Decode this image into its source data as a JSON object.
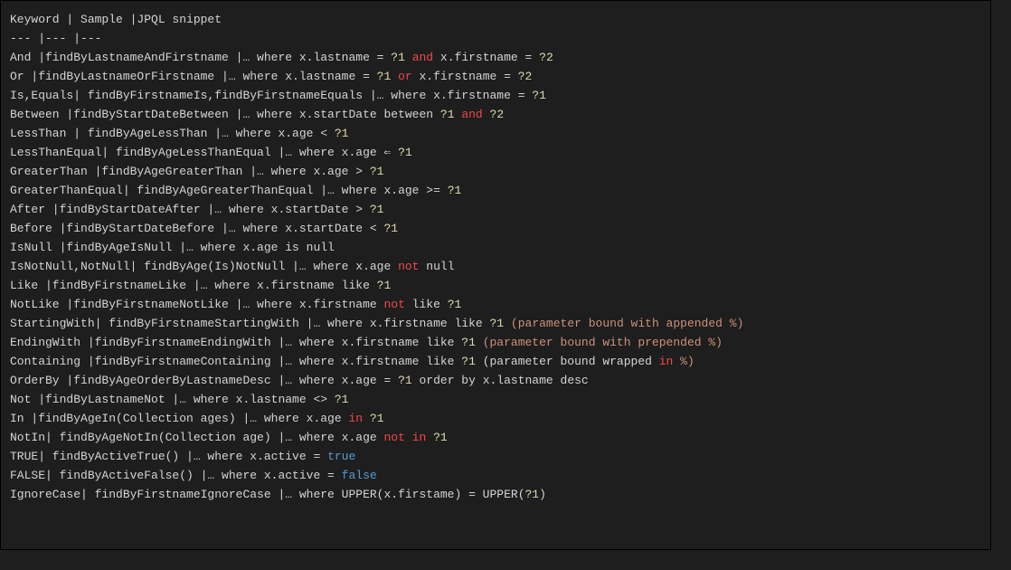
{
  "lines": [
    [
      [
        "white",
        "Keyword | Sample |JPQL snippet"
      ]
    ],
    [
      [
        "white",
        "--- |--- |---"
      ]
    ],
    [
      [
        "white",
        "And |findByLastnameAndFirstname |… where x.lastname = "
      ],
      [
        "yellow",
        "?1"
      ],
      [
        "white",
        " "
      ],
      [
        "red",
        "and"
      ],
      [
        "white",
        " x.firstname = "
      ],
      [
        "yellow",
        "?2"
      ]
    ],
    [
      [
        "white",
        "Or |findByLastnameOrFirstname |… where x.lastname = "
      ],
      [
        "yellow",
        "?1"
      ],
      [
        "white",
        " "
      ],
      [
        "red",
        "or"
      ],
      [
        "white",
        " x.firstname = "
      ],
      [
        "yellow",
        "?2"
      ]
    ],
    [
      [
        "white",
        "Is,Equals| findByFirstnameIs,findByFirstnameEquals |… where x.firstname = "
      ],
      [
        "yellow",
        "?1"
      ]
    ],
    [
      [
        "white",
        "Between |findByStartDateBetween |… where x.startDate between "
      ],
      [
        "yellow",
        "?1"
      ],
      [
        "white",
        " "
      ],
      [
        "red",
        "and"
      ],
      [
        "white",
        " "
      ],
      [
        "yellow",
        "?2"
      ]
    ],
    [
      [
        "white",
        "LessThan | findByAgeLessThan |… where x.age < "
      ],
      [
        "yellow",
        "?1"
      ]
    ],
    [
      [
        "white",
        "LessThanEqual| findByAgeLessThanEqual |… where x.age ⇐ "
      ],
      [
        "yellow",
        "?1"
      ]
    ],
    [
      [
        "white",
        "GreaterThan |findByAgeGreaterThan |… where x.age > "
      ],
      [
        "yellow",
        "?1"
      ]
    ],
    [
      [
        "white",
        "GreaterThanEqual| findByAgeGreaterThanEqual |… where x.age >= "
      ],
      [
        "yellow",
        "?1"
      ]
    ],
    [
      [
        "white",
        "After |findByStartDateAfter |… where x.startDate > "
      ],
      [
        "yellow",
        "?1"
      ]
    ],
    [
      [
        "white",
        "Before |findByStartDateBefore |… where x.startDate < "
      ],
      [
        "yellow",
        "?1"
      ]
    ],
    [
      [
        "white",
        "IsNull |findByAgeIsNull |… where x.age is null"
      ]
    ],
    [
      [
        "white",
        "IsNotNull,NotNull| findByAge(Is)NotNull |… where x.age "
      ],
      [
        "red",
        "not"
      ],
      [
        "white",
        " null"
      ]
    ],
    [
      [
        "white",
        "Like |findByFirstnameLike |… where x.firstname like "
      ],
      [
        "yellow",
        "?1"
      ]
    ],
    [
      [
        "white",
        "NotLike |findByFirstnameNotLike |… where x.firstname "
      ],
      [
        "red",
        "not"
      ],
      [
        "white",
        " like "
      ],
      [
        "yellow",
        "?1"
      ]
    ],
    [
      [
        "white",
        "StartingWith| findByFirstnameStartingWith |… where x.firstname like "
      ],
      [
        "yellow",
        "?1"
      ],
      [
        "white",
        " "
      ],
      [
        "orange",
        "(parameter bound with appended %)"
      ]
    ],
    [
      [
        "white",
        "EndingWith |findByFirstnameEndingWith |… where x.firstname like "
      ],
      [
        "yellow",
        "?1"
      ],
      [
        "white",
        " "
      ],
      [
        "orange",
        "(parameter bound with prepended %)"
      ]
    ],
    [
      [
        "white",
        "Containing |findByFirstnameContaining |… where x.firstname like "
      ],
      [
        "yellow",
        "?1"
      ],
      [
        "white",
        " (parameter bound wrapped "
      ],
      [
        "red",
        "in"
      ],
      [
        "white",
        " "
      ],
      [
        "orange",
        "%)"
      ]
    ],
    [
      [
        "white",
        "OrderBy |findByAgeOrderByLastnameDesc |… where x.age = "
      ],
      [
        "yellow",
        "?1"
      ],
      [
        "white",
        " order by x.lastname desc"
      ]
    ],
    [
      [
        "white",
        "Not |findByLastnameNot |… where x.lastname <> "
      ],
      [
        "yellow",
        "?1"
      ]
    ],
    [
      [
        "white",
        "In |findByAgeIn(Collection ages) |… where x.age "
      ],
      [
        "red",
        "in"
      ],
      [
        "white",
        " "
      ],
      [
        "yellow",
        "?1"
      ]
    ],
    [
      [
        "white",
        "NotIn| findByAgeNotIn(Collection age) |… where x.age "
      ],
      [
        "red",
        "not"
      ],
      [
        "white",
        " "
      ],
      [
        "red",
        "in"
      ],
      [
        "white",
        " "
      ],
      [
        "yellow",
        "?1"
      ]
    ],
    [
      [
        "white",
        "TRUE| findByActiveTrue() |… where x.active = "
      ],
      [
        "blue",
        "true"
      ]
    ],
    [
      [
        "white",
        "FALSE| findByActiveFalse() |… where x.active = "
      ],
      [
        "blue",
        "false"
      ]
    ],
    [
      [
        "white",
        "IgnoreCase| findByFirstnameIgnoreCase |… where UPPER(x.firstame) = UPPER("
      ],
      [
        "yellow",
        "?1"
      ],
      [
        "white",
        ")"
      ]
    ]
  ]
}
